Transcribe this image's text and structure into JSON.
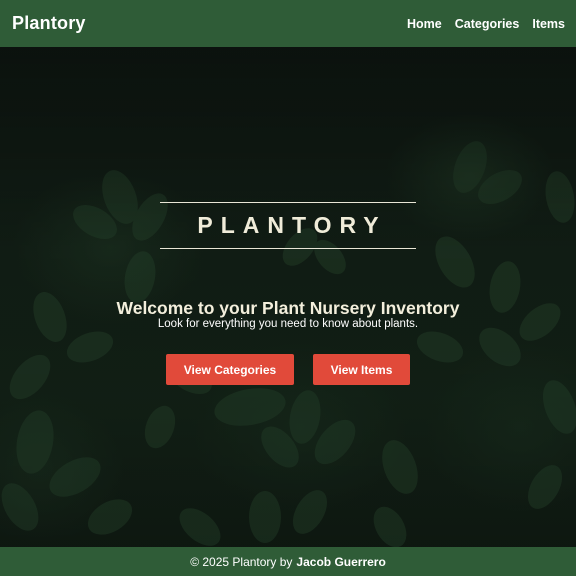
{
  "header": {
    "brand": "Plantory",
    "nav": [
      "Home",
      "Categories",
      "Items"
    ]
  },
  "hero": {
    "title": "PLANTORY",
    "welcome": "Welcome to your Plant Nursery Inventory",
    "tagline": "Look for everything you need to know about plants.",
    "buttons": {
      "categories": "View Categories",
      "items": "View Items"
    }
  },
  "footer": {
    "prefix": "© 2025 Plantory by",
    "author": "Jacob Guerrero"
  },
  "colors": {
    "header_bg": "#2f5c37",
    "button_bg": "#e14a3a",
    "title_text": "#f0ecd9"
  },
  "icons": [
    "leaf-foliage-background"
  ]
}
